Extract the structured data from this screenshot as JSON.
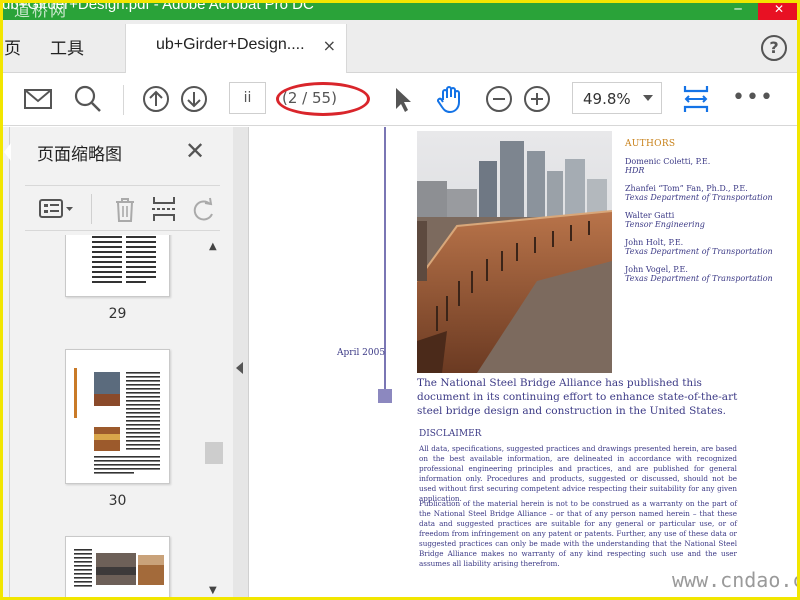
{
  "window": {
    "title": "ub+Girder+Design.pdf - Adobe Acrobat Pro DC",
    "watermark_top": "道桥网",
    "watermark_bottom": "www.cndao.com"
  },
  "menu": {
    "items": [
      "页",
      "工具"
    ]
  },
  "tab": {
    "label": "ub+Girder+Design....",
    "close": "×"
  },
  "help": {
    "label": "?"
  },
  "toolbar": {
    "page_current": "ii",
    "page_count": "(2 / 55)",
    "zoom": "49.8%",
    "more": "•••",
    "icons": [
      "mail-icon",
      "search-icon",
      "prev-page-icon",
      "next-page-icon",
      "select-pointer-icon",
      "hand-tool-icon",
      "zoom-out-icon",
      "zoom-in-icon",
      "fit-width-icon"
    ]
  },
  "sidebar": {
    "title": "页面缩略图",
    "close": "✕",
    "thumbnails": [
      {
        "page": "29"
      },
      {
        "page": "30"
      }
    ]
  },
  "document": {
    "date": "April 2005",
    "authors_header": "AUTHORS",
    "authors": [
      {
        "name": "Domenic Coletti, P.E.",
        "affiliation": "HDR"
      },
      {
        "name": "Zhanfei “Tom” Fan, Ph.D., P.E.",
        "affiliation": "Texas Department of Transportation"
      },
      {
        "name": "Walter Gatti",
        "affiliation": "Tensor Engineering"
      },
      {
        "name": "John Holt, P.E.",
        "affiliation": "Texas Department of Transportation"
      },
      {
        "name": "John Vogel, P.E.",
        "affiliation": "Texas Department of Transportation"
      }
    ],
    "intro": "The National Steel Bridge Alliance has published this document in its continuing effort to enhance state-of-the-art steel bridge design and construction in the United States.",
    "disclaimer_header": "DISCLAIMER",
    "disclaimer_p1": "All data, specifications, suggested practices and drawings presented herein, are based on the best available information, are delineated in accordance with recognized professional engineering principles and practices, and are published for general information only. Procedures and products, suggested or discussed, should not be used without first securing competent advice respecting their suitability for any given application.",
    "disclaimer_p2": "Publication of the material herein is not to be construed as a warranty on the part of the National Steel Bridge Alliance – or that of any person named herein – that these data and suggested practices are suitable for any general or particular use, or of freedom from infringement on any patent or patents. Further, any use of these data or suggested practices can only be made with the understanding that the National Steel Bridge Alliance makes no warranty of any kind respecting such use and the user assumes all liability arising therefrom."
  },
  "colors": {
    "titlebar": "#2aa339",
    "accent_blue": "#1473e6",
    "doc_text": "#3c3a86",
    "authors_header": "#c8821b",
    "annotation_red": "#d9252b",
    "frame_yellow": "#f2e600"
  }
}
